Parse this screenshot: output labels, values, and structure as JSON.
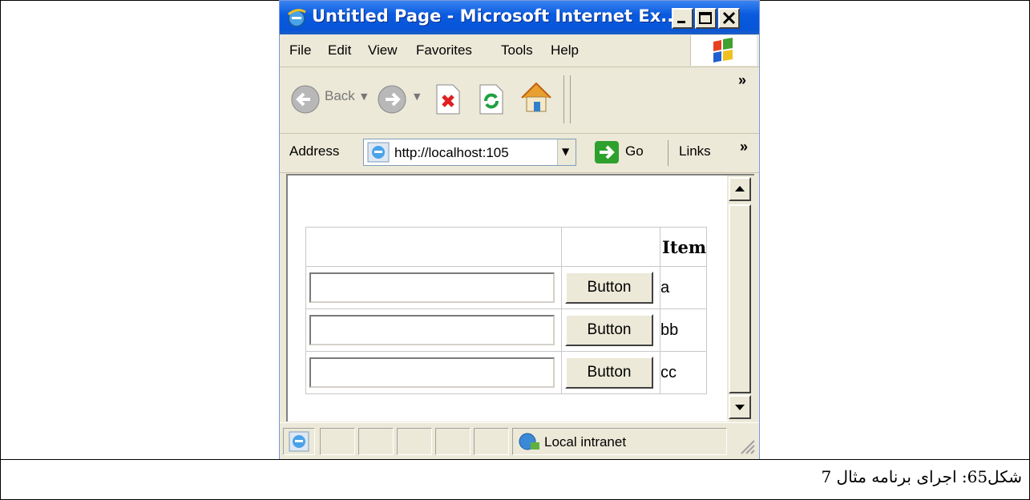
{
  "window": {
    "title": "Untitled Page - Microsoft Internet Ex...",
    "icon": "ie-icon",
    "controls": [
      "minimize-icon",
      "maximize-icon",
      "close-icon"
    ]
  },
  "menu": {
    "items": [
      "File",
      "Edit",
      "View",
      "Favorites",
      "Tools",
      "Help"
    ],
    "logo": "windows-flag-icon"
  },
  "toolbar": {
    "back_label": "Back",
    "buttons": [
      "back-icon",
      "forward-icon",
      "stop-icon",
      "refresh-icon",
      "home-icon"
    ],
    "more": "»"
  },
  "address": {
    "label": "Address",
    "value": "http://localhost:105",
    "go_label": "Go",
    "links_label": "Links",
    "more": "»"
  },
  "grid": {
    "header": "Item",
    "rows": [
      {
        "input_value": "",
        "button_label": "Button",
        "item": "a"
      },
      {
        "input_value": "",
        "button_label": "Button",
        "item": "bb"
      },
      {
        "input_value": "",
        "button_label": "Button",
        "item": "cc"
      }
    ]
  },
  "status": {
    "zone": "Local intranet"
  },
  "caption": "شکل65: اجرای برنامه مثال 7",
  "colors": {
    "titlebar": "#0a5be0",
    "chrome": "#ece9d8",
    "go_green": "#2ea02e"
  }
}
